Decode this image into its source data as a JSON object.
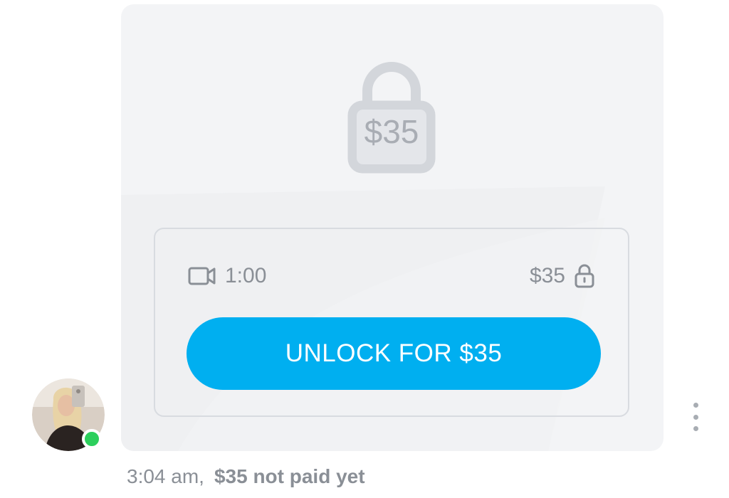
{
  "locked_message": {
    "lock_price": "$35",
    "media": {
      "icon": "video-camera-icon",
      "duration": "1:00"
    },
    "price": {
      "label": "$35",
      "icon": "lock-icon"
    },
    "unlock_button_label": "UNLOCK FOR $35",
    "colors": {
      "accent": "#00aff0",
      "card_background": "#f3f4f6",
      "muted_text": "#8a8f96",
      "online_indicator": "#2ccf5c"
    }
  },
  "sender": {
    "avatar_icon": "avatar",
    "online": true
  },
  "footer": {
    "timestamp": "3:04 am,",
    "payment_status": "$35 not paid yet"
  },
  "more_options_icon": "more-vertical-icon"
}
